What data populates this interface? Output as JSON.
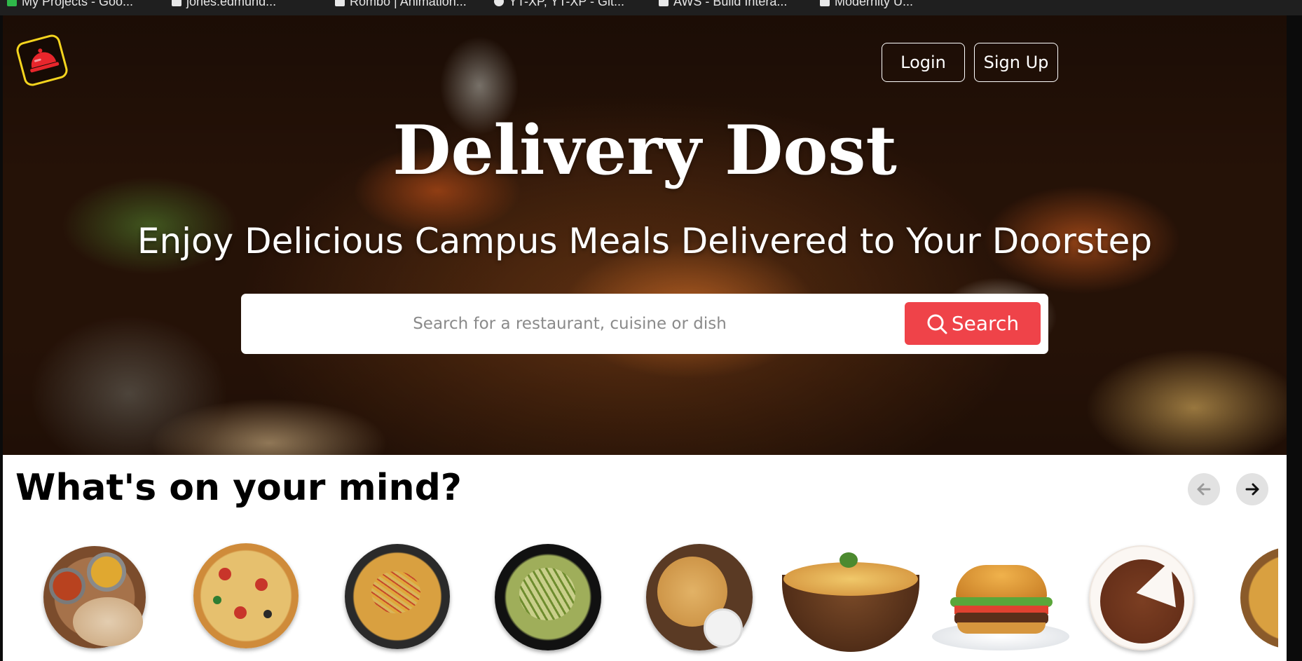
{
  "browser": {
    "bookmarks": [
      {
        "label": "My Projects - Goo..."
      },
      {
        "label": "jones.edmund..."
      },
      {
        "label": "Rombo | Animation..."
      },
      {
        "label": "YT-XP, YT-XP - Git..."
      },
      {
        "label": "AWS - Build Intera..."
      },
      {
        "label": "Modernity U..."
      }
    ]
  },
  "header": {
    "logo_icon": "food-cloche-icon",
    "login_label": "Login",
    "signup_label": "Sign Up"
  },
  "hero": {
    "title": "Delivery Dost",
    "subtitle": "Enjoy Delicious Campus Meals Delivered to Your Doorstep"
  },
  "search": {
    "placeholder": "Search for a restaurant, cuisine or dish",
    "value": "",
    "button_label": "Search",
    "button_icon": "search-icon"
  },
  "section": {
    "title": "What's on your mind?",
    "prev_icon": "arrow-left-icon",
    "next_icon": "arrow-right-icon"
  },
  "colors": {
    "accent": "#ef4349",
    "logo_border": "#f4d41e"
  },
  "food_items": [
    {
      "name": "thali"
    },
    {
      "name": "pizza"
    },
    {
      "name": "noodles"
    },
    {
      "name": "pasta"
    },
    {
      "name": "paratha"
    },
    {
      "name": "biryani"
    },
    {
      "name": "burger"
    },
    {
      "name": "cake"
    },
    {
      "name": "noodles"
    }
  ]
}
